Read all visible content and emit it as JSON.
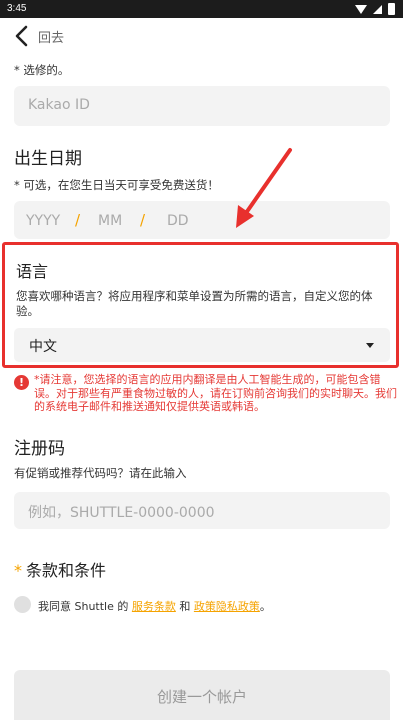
{
  "status_bar": {
    "time": "3:45"
  },
  "nav": {
    "back_label": "回去"
  },
  "kakao": {
    "note": "* 选修的。",
    "placeholder": "Kakao ID"
  },
  "birthday": {
    "title": "出生日期",
    "note": "* 可选，在您生日当天可享受免费送货！",
    "year": "YYYY",
    "month": "MM",
    "day": "DD",
    "separator": "/"
  },
  "language": {
    "title": "语言",
    "description": "您喜欢哪种语言？将应用程序和菜单设置为所需的语言，自定义您的体验。",
    "selected": "中文"
  },
  "warning": {
    "text": "*请注意，您选择的语言的应用内翻译是由人工智能生成的，可能包含错误。对于那些有严重食物过敏的人，请在订购前咨询我们的实时聊天。我们的系统电子邮件和推送通知仅提供英语或韩语。"
  },
  "referral": {
    "title": "注册码",
    "note": "有促销或推荐代码吗？请在此输入",
    "placeholder": "例如，SHUTTLE-0000-0000"
  },
  "terms": {
    "asterisk": "*",
    "title": "条款和条件",
    "agree_prefix": "我同意 Shuttle 的",
    "terms_link": "服务条款",
    "and": "和",
    "privacy_link": "政策隐私政策",
    "suffix": "。"
  },
  "submit": {
    "label": "创建一个帐户"
  },
  "colors": {
    "accent": "#f5a300",
    "highlight": "#e8302d",
    "warning": "#e53935"
  }
}
